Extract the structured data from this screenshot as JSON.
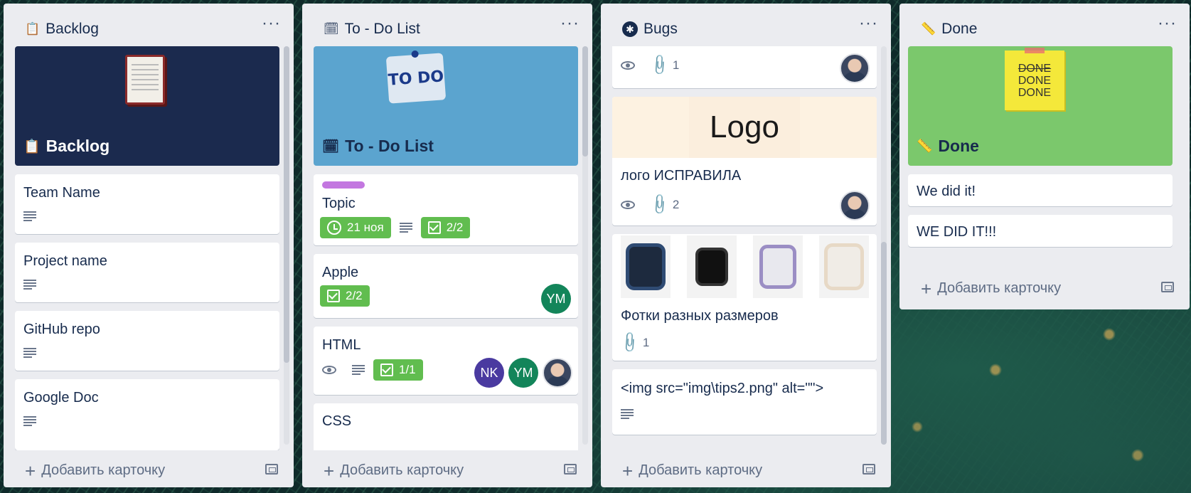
{
  "lists": {
    "backlog": {
      "title": "Backlog",
      "cover_title": "Backlog",
      "cards": [
        "Team Name",
        "Project name",
        "GitHub repo",
        "Google Doc"
      ],
      "add_label": "Добавить карточку"
    },
    "todo": {
      "title": "To - Do List",
      "cover_title": "To - Do List",
      "cover_note": "TO DO",
      "cards": {
        "topic": {
          "title": "Topic",
          "due": "21 ноя",
          "checklist": "2/2"
        },
        "apple": {
          "title": "Apple",
          "checklist": "2/2",
          "avatar": "YM"
        },
        "html": {
          "title": "HTML",
          "checklist": "1/1",
          "avatars": [
            "NK",
            "YM"
          ]
        },
        "css": {
          "title": "CSS"
        }
      },
      "add_label": "Добавить карточку"
    },
    "bugs": {
      "title": "Bugs",
      "cards": {
        "first": {
          "attachments": "1"
        },
        "logo": {
          "cover_text": "Logo",
          "title": "лого ИСПРАВИЛА",
          "attachments": "2"
        },
        "photos": {
          "title": "Фотки разных размеров",
          "attachments": "1"
        },
        "img": {
          "title": "<img src=\"img\\tips2.png\" alt=\"\">"
        }
      },
      "add_label": "Добавить карточку"
    },
    "done": {
      "title": "Done",
      "cover_title": "Done",
      "cover_note": [
        "DONE",
        "DONE",
        "DONE"
      ],
      "cards": [
        "We did it!",
        "WE DID IT!!!"
      ],
      "add_label": "Добавить карточку"
    }
  },
  "colors": {
    "backlog_cover": "#1b2a4e",
    "todo_cover": "#5ba4cf",
    "done_cover": "#7bc86c",
    "label_purple": "#c377e0",
    "pill_green": "#61bd4f",
    "avatar_nk": "#4a3aa0",
    "avatar_ym": "#13855a"
  },
  "icons": [
    "clipboard-icon",
    "calendar-icon",
    "bug-icon",
    "ruler-icon",
    "menu-dots-icon",
    "eye-icon",
    "paperclip-icon",
    "description-icon",
    "checklist-icon",
    "clock-icon",
    "plus-icon",
    "template-icon"
  ]
}
